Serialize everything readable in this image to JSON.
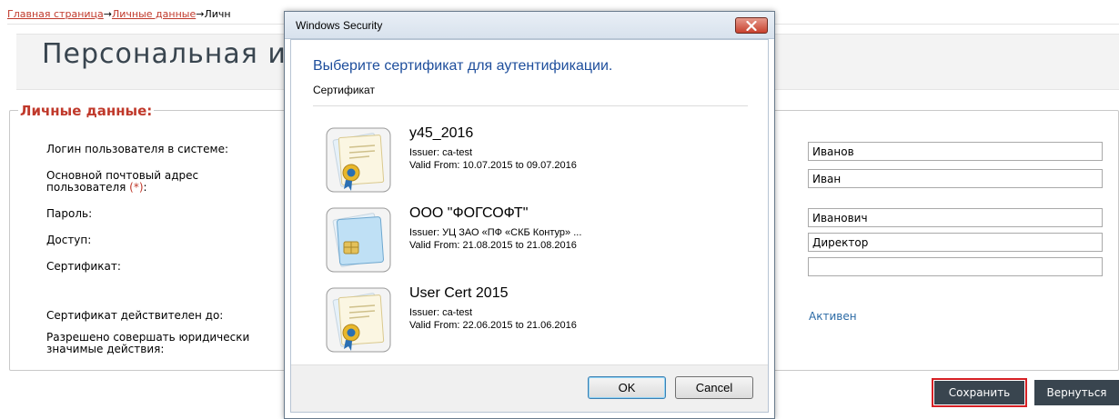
{
  "breadcrumb": {
    "home": "Главная страница",
    "arrow1": "→",
    "personal": "Личные данные",
    "arrow2": "→",
    "current": "Личн"
  },
  "page": {
    "title": "Персональная и",
    "legend": "Личные данные:"
  },
  "form": {
    "labels": {
      "login": "Логин пользователя в системе:",
      "email_line1": "Основной почтовый адрес",
      "email_line2": "пользователя",
      "email_req": "(*)",
      "email_colon": ":",
      "password": "Пароль:",
      "access": "Доступ:",
      "certificate": "Сертификат:",
      "cert_valid_until": "Сертификат действителен до:",
      "legal_line1": "Разрешено совершать юридически",
      "legal_line2": "значимые действия:"
    },
    "values": {
      "last_name": "Иванов",
      "first_name": "Иван",
      "middle_name": "Иванович",
      "position": "Директор",
      "extra": ""
    },
    "status": "Активен"
  },
  "buttons": {
    "save": "Сохранить",
    "back": "Вернуться"
  },
  "dialog": {
    "title": "Windows Security",
    "heading": "Выберите сертификат для аутентификации.",
    "subheading": "Сертификат",
    "certificates": [
      {
        "name": "y45_2016",
        "issuer": "Issuer: ca-test",
        "valid": "Valid From: 10.07.2015 to 09.07.2016",
        "icon": "certificate-seal-icon"
      },
      {
        "name": "ООО \"ФОГСОФТ\"",
        "issuer": "Issuer: УЦ ЗАО «ПФ «СКБ Контур» ...",
        "valid": "Valid From: 21.08.2015 to 21.08.2016",
        "icon": "smartcard-certificate-icon"
      },
      {
        "name": "User Cert 2015",
        "issuer": "Issuer: ca-test",
        "valid": "Valid From: 22.06.2015 to 21.06.2016",
        "icon": "certificate-seal-icon"
      }
    ],
    "ok": "OK",
    "cancel": "Cancel"
  },
  "colors": {
    "accent_red": "#c0392b",
    "button_dark": "#39454f",
    "status_blue": "#2b6aa5",
    "dialog_heading": "#1e4e9c"
  }
}
